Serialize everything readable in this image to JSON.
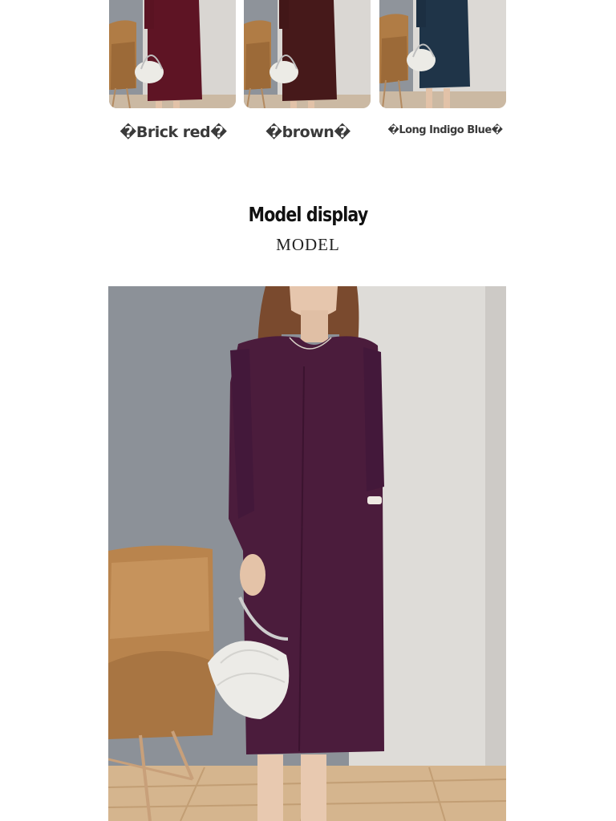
{
  "colors": [
    {
      "label": "�Brick red�",
      "dress": "#5e1424"
    },
    {
      "label": "�brown�",
      "dress": "#46191a"
    },
    {
      "label": "�Long Indigo Blue�",
      "dress": "#1f3448"
    }
  ],
  "section": {
    "title": "Model display",
    "subtitle": "MODEL"
  },
  "model_photo": {
    "dress_color": "#4b1c3c"
  }
}
